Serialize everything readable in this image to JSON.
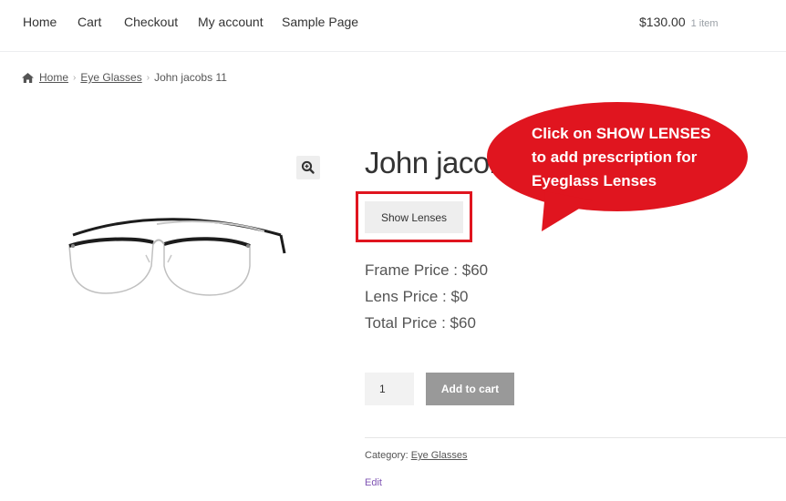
{
  "nav": {
    "items": [
      "Home",
      "Cart",
      "Checkout",
      "My account",
      "Sample Page"
    ],
    "cart_total": "$130.00",
    "cart_count": "1 item"
  },
  "breadcrumb": {
    "home": "Home",
    "category": "Eye Glasses",
    "current": "John jacobs 11"
  },
  "product": {
    "title": "John jacobs 11",
    "show_lenses_label": "Show Lenses",
    "frame_price": "Frame Price : $60",
    "lens_price": "Lens Price : $0",
    "total_price": "Total Price : $60",
    "quantity": "1",
    "add_to_cart_label": "Add to cart",
    "category_label": "Category:",
    "category_value": "Eye Glasses",
    "edit_label": "Edit"
  },
  "callout": {
    "lines": [
      "Click on SHOW LENSES",
      "to add prescription for",
      "Eyeglass Lenses"
    ],
    "color": "#e0151f"
  },
  "icons": {
    "home": "home-icon",
    "zoom": "zoom-icon"
  }
}
